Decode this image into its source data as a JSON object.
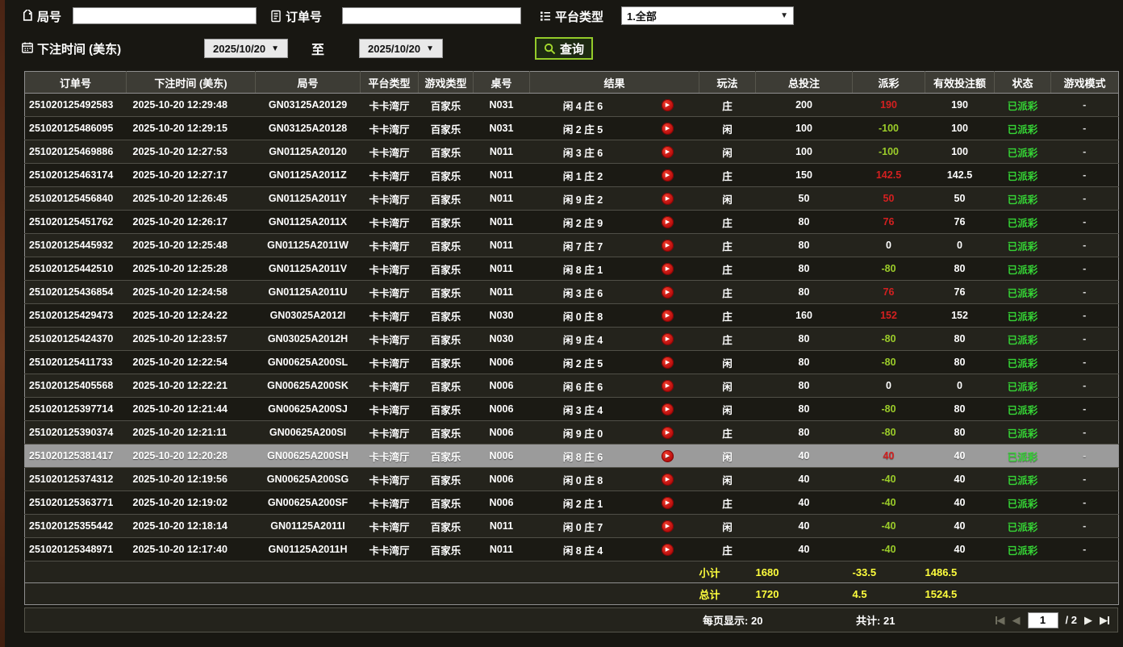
{
  "filters": {
    "round_label": "局号",
    "round_value": "",
    "order_label": "订单号",
    "order_value": "",
    "platform_label": "平台类型",
    "platform_value": "1.全部",
    "bet_time_label": "下注时间 (美东)",
    "date_from": "2025/10/20",
    "to_label": "至",
    "date_to": "2025/10/20",
    "query_label": "查询"
  },
  "table": {
    "headers": [
      "订单号",
      "下注时间 (美东)",
      "局号",
      "平台类型",
      "游戏类型",
      "桌号",
      "结果",
      "玩法",
      "总投注",
      "派彩",
      "有效投注额",
      "状态",
      "游戏模式"
    ],
    "rows": [
      {
        "order": "251020125492583",
        "time": "2025-10-20 12:29:48",
        "round": "GN03125A20129",
        "platform": "卡卡湾厅",
        "game": "百家乐",
        "table_no": "N031",
        "result": "闲 4 庄 6",
        "play_type": "庄",
        "total_bet": "200",
        "payout": "190",
        "pay": "pos",
        "valid": "190",
        "status": "已派彩",
        "mode": "-",
        "selected": false
      },
      {
        "order": "251020125486095",
        "time": "2025-10-20 12:29:15",
        "round": "GN03125A20128",
        "platform": "卡卡湾厅",
        "game": "百家乐",
        "table_no": "N031",
        "result": "闲 2 庄 5",
        "play_type": "闲",
        "total_bet": "100",
        "payout": "-100",
        "pay": "neg",
        "valid": "100",
        "status": "已派彩",
        "mode": "-",
        "selected": false
      },
      {
        "order": "251020125469886",
        "time": "2025-10-20 12:27:53",
        "round": "GN01125A20120",
        "platform": "卡卡湾厅",
        "game": "百家乐",
        "table_no": "N011",
        "result": "闲 3 庄 6",
        "play_type": "闲",
        "total_bet": "100",
        "payout": "-100",
        "pay": "neg",
        "valid": "100",
        "status": "已派彩",
        "mode": "-",
        "selected": false
      },
      {
        "order": "251020125463174",
        "time": "2025-10-20 12:27:17",
        "round": "GN01125A2011Z",
        "platform": "卡卡湾厅",
        "game": "百家乐",
        "table_no": "N011",
        "result": "闲 1 庄 2",
        "play_type": "庄",
        "total_bet": "150",
        "payout": "142.5",
        "pay": "pos",
        "valid": "142.5",
        "status": "已派彩",
        "mode": "-",
        "selected": false
      },
      {
        "order": "251020125456840",
        "time": "2025-10-20 12:26:45",
        "round": "GN01125A2011Y",
        "platform": "卡卡湾厅",
        "game": "百家乐",
        "table_no": "N011",
        "result": "闲 9 庄 2",
        "play_type": "闲",
        "total_bet": "50",
        "payout": "50",
        "pay": "pos",
        "valid": "50",
        "status": "已派彩",
        "mode": "-",
        "selected": false
      },
      {
        "order": "251020125451762",
        "time": "2025-10-20 12:26:17",
        "round": "GN01125A2011X",
        "platform": "卡卡湾厅",
        "game": "百家乐",
        "table_no": "N011",
        "result": "闲 2 庄 9",
        "play_type": "庄",
        "total_bet": "80",
        "payout": "76",
        "pay": "pos",
        "valid": "76",
        "status": "已派彩",
        "mode": "-",
        "selected": false
      },
      {
        "order": "251020125445932",
        "time": "2025-10-20 12:25:48",
        "round": "GN01125A2011W",
        "platform": "卡卡湾厅",
        "game": "百家乐",
        "table_no": "N011",
        "result": "闲 7 庄 7",
        "play_type": "庄",
        "total_bet": "80",
        "payout": "0",
        "pay": "zero",
        "valid": "0",
        "status": "已派彩",
        "mode": "-",
        "selected": false
      },
      {
        "order": "251020125442510",
        "time": "2025-10-20 12:25:28",
        "round": "GN01125A2011V",
        "platform": "卡卡湾厅",
        "game": "百家乐",
        "table_no": "N011",
        "result": "闲 8 庄 1",
        "play_type": "庄",
        "total_bet": "80",
        "payout": "-80",
        "pay": "neg",
        "valid": "80",
        "status": "已派彩",
        "mode": "-",
        "selected": false
      },
      {
        "order": "251020125436854",
        "time": "2025-10-20 12:24:58",
        "round": "GN01125A2011U",
        "platform": "卡卡湾厅",
        "game": "百家乐",
        "table_no": "N011",
        "result": "闲 3 庄 6",
        "play_type": "庄",
        "total_bet": "80",
        "payout": "76",
        "pay": "pos",
        "valid": "76",
        "status": "已派彩",
        "mode": "-",
        "selected": false
      },
      {
        "order": "251020125429473",
        "time": "2025-10-20 12:24:22",
        "round": "GN03025A2012I",
        "platform": "卡卡湾厅",
        "game": "百家乐",
        "table_no": "N030",
        "result": "闲 0 庄 8",
        "play_type": "庄",
        "total_bet": "160",
        "payout": "152",
        "pay": "pos",
        "valid": "152",
        "status": "已派彩",
        "mode": "-",
        "selected": false
      },
      {
        "order": "251020125424370",
        "time": "2025-10-20 12:23:57",
        "round": "GN03025A2012H",
        "platform": "卡卡湾厅",
        "game": "百家乐",
        "table_no": "N030",
        "result": "闲 9 庄 4",
        "play_type": "庄",
        "total_bet": "80",
        "payout": "-80",
        "pay": "neg",
        "valid": "80",
        "status": "已派彩",
        "mode": "-",
        "selected": false
      },
      {
        "order": "251020125411733",
        "time": "2025-10-20 12:22:54",
        "round": "GN00625A200SL",
        "platform": "卡卡湾厅",
        "game": "百家乐",
        "table_no": "N006",
        "result": "闲 2 庄 5",
        "play_type": "闲",
        "total_bet": "80",
        "payout": "-80",
        "pay": "neg",
        "valid": "80",
        "status": "已派彩",
        "mode": "-",
        "selected": false
      },
      {
        "order": "251020125405568",
        "time": "2025-10-20 12:22:21",
        "round": "GN00625A200SK",
        "platform": "卡卡湾厅",
        "game": "百家乐",
        "table_no": "N006",
        "result": "闲 6 庄 6",
        "play_type": "闲",
        "total_bet": "80",
        "payout": "0",
        "pay": "zero",
        "valid": "0",
        "status": "已派彩",
        "mode": "-",
        "selected": false
      },
      {
        "order": "251020125397714",
        "time": "2025-10-20 12:21:44",
        "round": "GN00625A200SJ",
        "platform": "卡卡湾厅",
        "game": "百家乐",
        "table_no": "N006",
        "result": "闲 3 庄 4",
        "play_type": "闲",
        "total_bet": "80",
        "payout": "-80",
        "pay": "neg",
        "valid": "80",
        "status": "已派彩",
        "mode": "-",
        "selected": false
      },
      {
        "order": "251020125390374",
        "time": "2025-10-20 12:21:11",
        "round": "GN00625A200SI",
        "platform": "卡卡湾厅",
        "game": "百家乐",
        "table_no": "N006",
        "result": "闲 9 庄 0",
        "play_type": "庄",
        "total_bet": "80",
        "payout": "-80",
        "pay": "neg",
        "valid": "80",
        "status": "已派彩",
        "mode": "-",
        "selected": false
      },
      {
        "order": "251020125381417",
        "time": "2025-10-20 12:20:28",
        "round": "GN00625A200SH",
        "platform": "卡卡湾厅",
        "game": "百家乐",
        "table_no": "N006",
        "result": "闲 8 庄 6",
        "play_type": "闲",
        "total_bet": "40",
        "payout": "40",
        "pay": "pos",
        "valid": "40",
        "status": "已派彩",
        "mode": "-",
        "selected": true
      },
      {
        "order": "251020125374312",
        "time": "2025-10-20 12:19:56",
        "round": "GN00625A200SG",
        "platform": "卡卡湾厅",
        "game": "百家乐",
        "table_no": "N006",
        "result": "闲 0 庄 8",
        "play_type": "闲",
        "total_bet": "40",
        "payout": "-40",
        "pay": "neg",
        "valid": "40",
        "status": "已派彩",
        "mode": "-",
        "selected": false
      },
      {
        "order": "251020125363771",
        "time": "2025-10-20 12:19:02",
        "round": "GN00625A200SF",
        "platform": "卡卡湾厅",
        "game": "百家乐",
        "table_no": "N006",
        "result": "闲 2 庄 1",
        "play_type": "庄",
        "total_bet": "40",
        "payout": "-40",
        "pay": "neg",
        "valid": "40",
        "status": "已派彩",
        "mode": "-",
        "selected": false
      },
      {
        "order": "251020125355442",
        "time": "2025-10-20 12:18:14",
        "round": "GN01125A2011I",
        "platform": "卡卡湾厅",
        "game": "百家乐",
        "table_no": "N011",
        "result": "闲 0 庄 7",
        "play_type": "闲",
        "total_bet": "40",
        "payout": "-40",
        "pay": "neg",
        "valid": "40",
        "status": "已派彩",
        "mode": "-",
        "selected": false
      },
      {
        "order": "251020125348971",
        "time": "2025-10-20 12:17:40",
        "round": "GN01125A2011H",
        "platform": "卡卡湾厅",
        "game": "百家乐",
        "table_no": "N011",
        "result": "闲 8 庄 4",
        "play_type": "庄",
        "total_bet": "40",
        "payout": "-40",
        "pay": "neg",
        "valid": "40",
        "status": "已派彩",
        "mode": "-",
        "selected": false
      }
    ],
    "subtotal": {
      "label": "小计",
      "total_bet": "1680",
      "payout": "-33.5",
      "valid": "1486.5"
    },
    "total": {
      "label": "总计",
      "total_bet": "1720",
      "payout": "4.5",
      "valid": "1524.5"
    }
  },
  "pagination": {
    "per_page_label": "每页显示:",
    "per_page_value": "20",
    "total_label": "共计:",
    "total_value": "21",
    "page_input": "1",
    "page_suffix": "/ 2"
  }
}
